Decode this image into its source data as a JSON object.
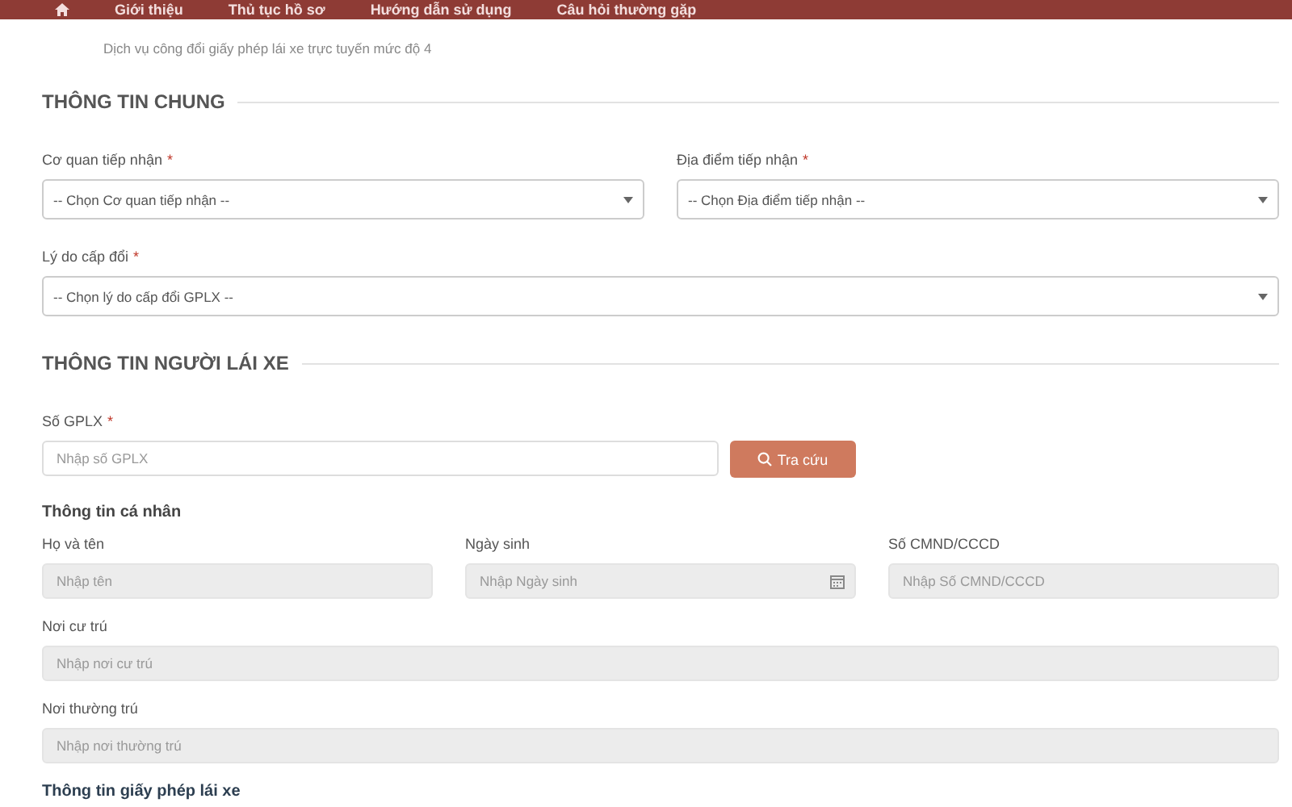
{
  "nav": {
    "items": [
      "Giới thiệu",
      "Thủ tục hồ sơ",
      "Hướng dẫn sử dụng",
      "Câu hỏi thường gặp"
    ]
  },
  "breadcrumb": "Dịch vụ công đổi giấy phép lái xe trực tuyến mức độ 4",
  "general": {
    "title": "THÔNG TIN CHUNG",
    "rows": [
      [
        {
          "label": "Cơ quan tiếp nhận",
          "required_mark": "*",
          "kind": "select",
          "placeholder": "-- Chọn Cơ quan tiếp nhận --"
        },
        {
          "label": "Địa điểm tiếp nhận",
          "required_mark": "*",
          "kind": "select",
          "placeholder": "-- Chọn Địa điểm tiếp nhận --"
        }
      ],
      [
        {
          "label": "Lý do cấp đổi",
          "required_mark": "*",
          "kind": "select",
          "placeholder": "-- Chọn lý do cấp đổi GPLX --"
        }
      ]
    ]
  },
  "driver": {
    "title": "THÔNG TIN NGƯỜI LÁI XE",
    "license": {
      "label": "Số GPLX",
      "required_mark": "*",
      "placeholder": "Nhập số GPLX"
    },
    "lookup_button": "Tra cứu",
    "personal_title": "Thông tin cá nhân",
    "rows": [
      [
        {
          "label": "Họ và tên",
          "kind": "text",
          "placeholder": "Nhập tên",
          "disabled": true
        },
        {
          "label": "Ngày sinh",
          "kind": "date",
          "placeholder": "Nhập Ngày sinh",
          "disabled": true
        },
        {
          "label": "Số CMND/CCCD",
          "kind": "text",
          "placeholder": "Nhập Số CMND/CCCD",
          "disabled": true
        }
      ],
      [
        {
          "label": "Nơi cư trú",
          "kind": "text",
          "placeholder": "Nhập nơi cư trú",
          "disabled": true
        }
      ],
      [
        {
          "label": "Nơi thường trú",
          "kind": "text",
          "placeholder": "Nhập nơi thường trú",
          "disabled": true
        }
      ]
    ],
    "license_title": "Thông tin giấy phép lái xe"
  }
}
